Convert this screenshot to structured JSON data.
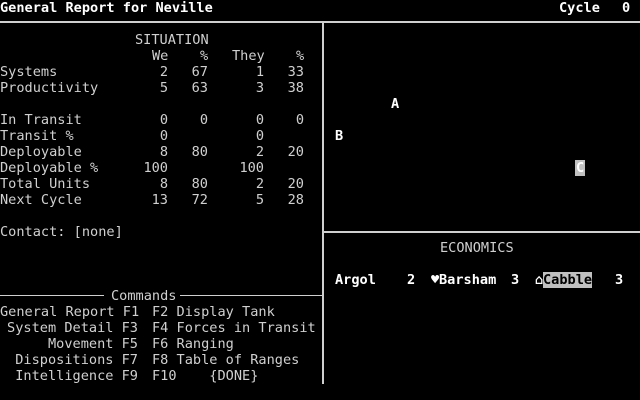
{
  "header": {
    "title": "General Report for Neville",
    "cycle_label": "Cycle",
    "cycle_value": "0"
  },
  "situation": {
    "title": "SITUATION",
    "col_we": "We",
    "col_pct1": "%",
    "col_they": "They",
    "col_pct2": "%",
    "rows": [
      {
        "label": "Systems",
        "we": "2",
        "wp": "67",
        "they": "1",
        "tp": "33"
      },
      {
        "label": "Productivity",
        "we": "5",
        "wp": "63",
        "they": "3",
        "tp": "38"
      },
      {
        "label": "In Transit",
        "we": "0",
        "wp": "0",
        "they": "0",
        "tp": "0"
      },
      {
        "label": "Transit %",
        "we": "0",
        "wp": "",
        "they": "0",
        "tp": ""
      },
      {
        "label": "Deployable",
        "we": "8",
        "wp": "80",
        "they": "2",
        "tp": "20"
      },
      {
        "label": "Deployable %",
        "we": "100",
        "wp": "",
        "they": "100",
        "tp": ""
      },
      {
        "label": "Total Units",
        "we": "8",
        "wp": "80",
        "they": "2",
        "tp": "20"
      },
      {
        "label": "Next Cycle",
        "we": "13",
        "wp": "72",
        "they": "5",
        "tp": "28"
      }
    ],
    "contact": "Contact: [none]"
  },
  "commands": {
    "title": "Commands",
    "items": [
      "General Report F1",
      "System Detail F3",
      "Movement F5",
      "Dispositions F7",
      "Intelligence F9",
      "F2 Display Tank",
      "F4 Forces in Transit",
      "F6 Ranging",
      "F8 Table of Ranges",
      "F10    {DONE}"
    ]
  },
  "map": {
    "stars": [
      "A",
      "B",
      "C"
    ],
    "selected": "C"
  },
  "economics": {
    "title": "ECONOMICS",
    "systems": [
      {
        "name": "Argol",
        "value": "2",
        "icon": ""
      },
      {
        "name": "Barsham",
        "value": "3",
        "icon": "♥"
      },
      {
        "name": "Cabble",
        "value": "3",
        "icon": "⌂"
      }
    ]
  }
}
